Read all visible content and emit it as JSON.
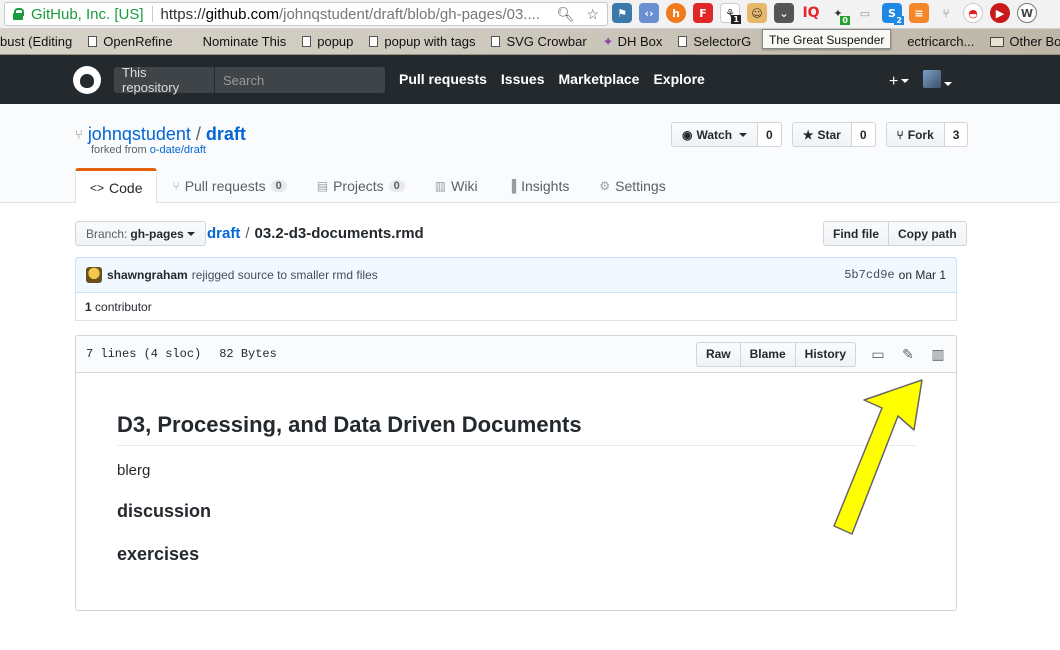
{
  "browser": {
    "site_identity": "GitHub, Inc. [US]",
    "url_scheme": "https://",
    "url_domain": "github.com",
    "url_path": "/johnqstudent/draft/blob/gh-pages/03....",
    "bookmarks": [
      "bust (Editing",
      "OpenRefine",
      "Nominate This",
      "popup",
      "popup with tags",
      "SVG Crowbar",
      "DH Box",
      "SelectorG",
      "ectricarch...",
      "Other Bo"
    ],
    "tooltip": "The Great Suspender",
    "extension_icons": [
      "python-icon",
      "code-icon",
      "h-icon",
      "flipboard-icon",
      "dark-reader-icon",
      "suspender-icon",
      "pocket-icon",
      "iq-icon",
      "wand-icon",
      "comment-icon",
      "skype-icon",
      "calculator-icon",
      "fork-icon",
      "pokeball-icon",
      "play-icon",
      "wordpress-icon"
    ],
    "ext_badges": {
      "dark_reader": "1",
      "wand": "0",
      "skype": "2"
    }
  },
  "github": {
    "search_scope": "This repository",
    "search_placeholder": "Search",
    "nav": [
      "Pull requests",
      "Issues",
      "Marketplace",
      "Explore"
    ],
    "plus": "+"
  },
  "repo": {
    "owner": "johnqstudent",
    "name": "draft",
    "forked_prefix": "forked from ",
    "forked_from": "o-date/draft",
    "watch_label": "Watch",
    "watch_count": "0",
    "star_label": "Star",
    "star_count": "0",
    "fork_label": "Fork",
    "fork_count": "3",
    "tabs": [
      {
        "label": "Code",
        "icon": "<>"
      },
      {
        "label": "Pull requests",
        "count": "0"
      },
      {
        "label": "Projects",
        "count": "0"
      },
      {
        "label": "Wiki"
      },
      {
        "label": "Insights"
      },
      {
        "label": "Settings"
      }
    ]
  },
  "file_nav": {
    "branch_prefix": "Branch:",
    "branch": "gh-pages",
    "crumb_repo": "draft",
    "separator": "/",
    "filename": "03.2-d3-documents.rmd",
    "find_file": "Find file",
    "copy_path": "Copy path"
  },
  "commit": {
    "author": "shawngraham",
    "message": "rejigged source to smaller rmd files",
    "sha": "5b7cd9e",
    "date": "on Mar 1",
    "contributors_count": "1",
    "contributors_label": "contributor"
  },
  "file": {
    "lines": "7 lines (4 sloc)",
    "size": "82 Bytes",
    "raw": "Raw",
    "blame": "Blame",
    "history": "History",
    "content": {
      "h2": "D3, Processing, and Data Driven Documents",
      "p": "blerg",
      "h3a": "discussion",
      "h3b": "exercises"
    }
  },
  "colors": {
    "header_bg": "#24292e",
    "link": "#0366d6",
    "tab_accent": "#e36209",
    "annotation_arrow": "#ffff00"
  }
}
